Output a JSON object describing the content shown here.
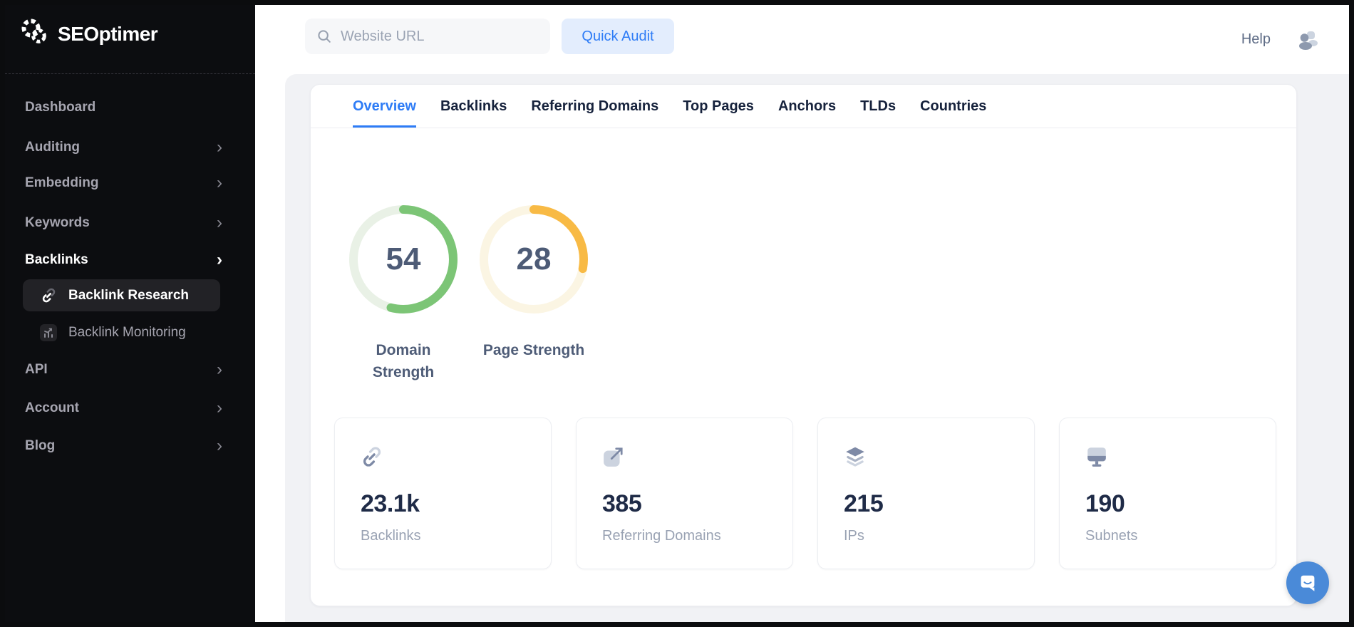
{
  "sidebar": {
    "logo_text": "SEOptimer",
    "chevron_glyph": "›",
    "items": [
      {
        "label": "Dashboard"
      },
      {
        "label": "Auditing"
      },
      {
        "label": "Embedding"
      },
      {
        "label": "Keywords"
      },
      {
        "label": "Backlinks"
      },
      {
        "label": "API"
      },
      {
        "label": "Account"
      },
      {
        "label": "Blog"
      }
    ],
    "subitems": [
      {
        "label": "Backlink Research"
      },
      {
        "label": "Backlink Monitoring"
      }
    ]
  },
  "topbar": {
    "search_placeholder": "Website URL",
    "quick_audit_label": "Quick Audit",
    "help_label": "Help"
  },
  "tabs": [
    {
      "label": "Overview"
    },
    {
      "label": "Backlinks"
    },
    {
      "label": "Referring Domains"
    },
    {
      "label": "Top Pages"
    },
    {
      "label": "Anchors"
    },
    {
      "label": "TLDs"
    },
    {
      "label": "Countries"
    }
  ],
  "overview": {
    "gauges": [
      {
        "value": "54",
        "label": "Domain Strength",
        "color": "#7cc576",
        "track": "#e9f1e6"
      },
      {
        "value": "28",
        "label": "Page Strength",
        "color": "#f8ba45",
        "track": "#fbf5e3"
      }
    ],
    "stats": [
      {
        "value": "23.1k",
        "label": "Backlinks",
        "icon": "link-icon"
      },
      {
        "value": "385",
        "label": "Referring Domains",
        "icon": "external-link-icon"
      },
      {
        "value": "215",
        "label": "IPs",
        "icon": "layers-icon"
      },
      {
        "value": "190",
        "label": "Subnets",
        "icon": "monitor-icon"
      }
    ]
  },
  "colors": {
    "accent_blue": "#2e7cf6",
    "sidebar_bg": "#0c0d10",
    "panel_bg": "#f1f2f5",
    "gauge_green": "#7cc576",
    "gauge_yellow": "#f8ba45",
    "chat_blue": "#4a8ad8"
  }
}
